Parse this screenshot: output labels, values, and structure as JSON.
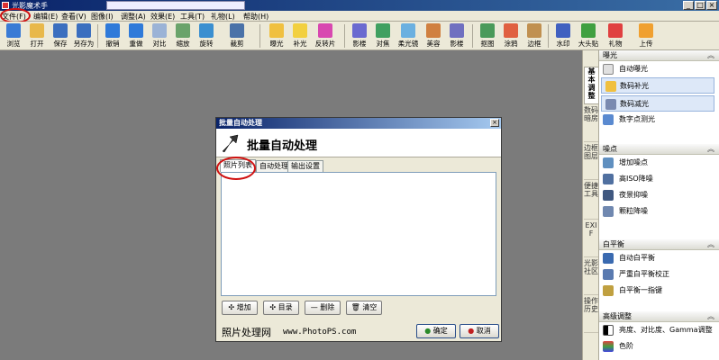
{
  "window": {
    "title": "光影魔术手",
    "controls": [
      "_",
      "□",
      "×"
    ]
  },
  "menu": [
    "文件(F)",
    "编辑(E)",
    "查看(V)",
    "图像(I)",
    "调整(A)",
    "效果(E)",
    "工具(T)",
    "礼物(L)",
    "帮助(H)"
  ],
  "toolbar": [
    "浏览",
    "打开",
    "保存",
    "另存为",
    "撤销",
    "重做",
    "对比",
    "缩放",
    "旋转",
    "裁剪",
    "曝光",
    "补光",
    "反转片",
    "影楼",
    "对焦",
    "柔光镜",
    "美容",
    "影楼",
    "抠图",
    "涂鸦",
    "边框",
    "水印",
    "大头贴",
    "礼物",
    "上传"
  ],
  "toolbar_icon_colors": [
    "#3a7bd5",
    "#e8b84a",
    "#3b6fbf",
    "#3b6fbf",
    "#2f7ad9",
    "#2f7ad9",
    "#9bb3d6",
    "#6aa36a",
    "#3a8fd0",
    "#4a72a8",
    "#f0c040",
    "#f2d040",
    "#d848b0",
    "#6a6ad0",
    "#40a060",
    "#6bb0e0",
    "#d08040",
    "#7070c0",
    "#4a9a5a",
    "#e06040",
    "#c09050",
    "#4060c0",
    "#40a040",
    "#e04040",
    "#f0a030"
  ],
  "right_panel": {
    "vertical_tabs": [
      "基本调整",
      "数码暗房",
      "边框图层",
      "便捷工具",
      "EXIF",
      "光影社区",
      "操作历史"
    ],
    "sections": [
      {
        "title": "曝光",
        "items": [
          "自动曝光",
          "数码补光",
          "数码减光",
          "数字点测光"
        ],
        "selected": [
          1,
          2
        ]
      },
      {
        "title": "噪点",
        "items": [
          "增加噪点",
          "高ISO降噪",
          "夜景抑噪",
          "颗粒降噪"
        ]
      },
      {
        "title": "白平衡",
        "items": [
          "自动白平衡",
          "严重白平衡校正",
          "白平衡一指键"
        ]
      },
      {
        "title": "高级调整",
        "items": [
          "亮度、对比度、Gamma调整",
          "色阶"
        ]
      }
    ]
  },
  "dialog": {
    "title": "批量自动处理",
    "heading": "批量自动处理",
    "tabs": [
      "照片列表",
      "自动处理",
      "输出设置"
    ],
    "active_tab": 0,
    "buttons": [
      "增加",
      "目录",
      "删除",
      "清空"
    ],
    "footer_brand": "照片处理网",
    "footer_url": "www.PhotoPS.com",
    "ok": "确定",
    "cancel": "取消"
  }
}
